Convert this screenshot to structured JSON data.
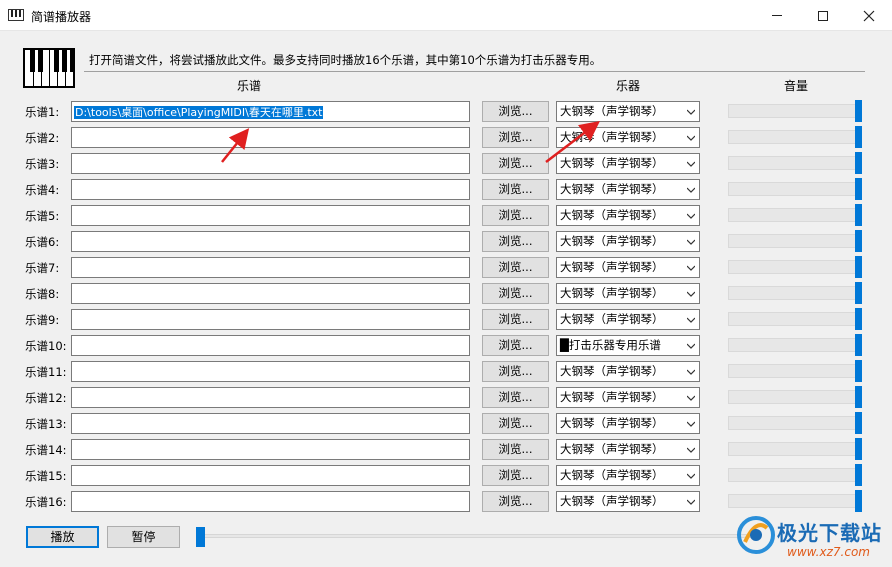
{
  "window": {
    "title": "简谱播放器",
    "controls": [
      "minimize",
      "maximize",
      "close"
    ]
  },
  "header": {
    "description": "打开简谱文件，将尝试播放此文件。最多支持同时播放16个乐谱，其中第10个乐谱为打击乐器专用。",
    "col_score": "乐谱",
    "col_instrument": "乐器",
    "col_volume": "音量"
  },
  "rows": [
    {
      "label": "乐谱1:",
      "path": "D:\\tools\\桌面\\office\\PlayingMIDI\\春天在哪里.txt",
      "browse": "浏览...",
      "instrument": "大钢琴（声学钢琴）",
      "volume": 1.0
    },
    {
      "label": "乐谱2:",
      "path": "",
      "browse": "浏览...",
      "instrument": "大钢琴（声学钢琴）",
      "volume": 1.0
    },
    {
      "label": "乐谱3:",
      "path": "",
      "browse": "浏览...",
      "instrument": "大钢琴（声学钢琴）",
      "volume": 1.0
    },
    {
      "label": "乐谱4:",
      "path": "",
      "browse": "浏览...",
      "instrument": "大钢琴（声学钢琴）",
      "volume": 1.0
    },
    {
      "label": "乐谱5:",
      "path": "",
      "browse": "浏览...",
      "instrument": "大钢琴（声学钢琴）",
      "volume": 1.0
    },
    {
      "label": "乐谱6:",
      "path": "",
      "browse": "浏览...",
      "instrument": "大钢琴（声学钢琴）",
      "volume": 1.0
    },
    {
      "label": "乐谱7:",
      "path": "",
      "browse": "浏览...",
      "instrument": "大钢琴（声学钢琴）",
      "volume": 1.0
    },
    {
      "label": "乐谱8:",
      "path": "",
      "browse": "浏览...",
      "instrument": "大钢琴（声学钢琴）",
      "volume": 1.0
    },
    {
      "label": "乐谱9:",
      "path": "",
      "browse": "浏览...",
      "instrument": "大钢琴（声学钢琴）",
      "volume": 1.0
    },
    {
      "label": "乐谱10:",
      "path": "",
      "browse": "浏览...",
      "instrument": "█打击乐器专用乐谱",
      "volume": 1.0
    },
    {
      "label": "乐谱11:",
      "path": "",
      "browse": "浏览...",
      "instrument": "大钢琴（声学钢琴）",
      "volume": 1.0
    },
    {
      "label": "乐谱12:",
      "path": "",
      "browse": "浏览...",
      "instrument": "大钢琴（声学钢琴）",
      "volume": 1.0
    },
    {
      "label": "乐谱13:",
      "path": "",
      "browse": "浏览...",
      "instrument": "大钢琴（声学钢琴）",
      "volume": 1.0
    },
    {
      "label": "乐谱14:",
      "path": "",
      "browse": "浏览...",
      "instrument": "大钢琴（声学钢琴）",
      "volume": 1.0
    },
    {
      "label": "乐谱15:",
      "path": "",
      "browse": "浏览...",
      "instrument": "大钢琴（声学钢琴）",
      "volume": 1.0
    },
    {
      "label": "乐谱16:",
      "path": "",
      "browse": "浏览...",
      "instrument": "大钢琴（声学钢琴）",
      "volume": 1.0
    }
  ],
  "footer": {
    "play": "播放",
    "pause": "暂停",
    "progress": 0.0
  },
  "watermark": {
    "title": "极光下载站",
    "url": "www.xz7.com"
  },
  "colors": {
    "accent": "#0078d7",
    "annotation_arrow": "#e02020"
  }
}
